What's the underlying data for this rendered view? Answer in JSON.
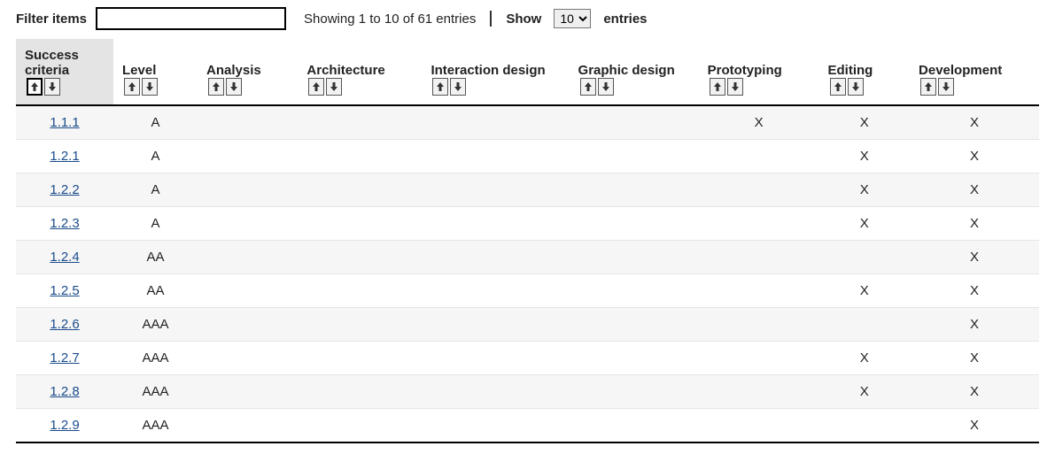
{
  "filter": {
    "label": "Filter items",
    "value": ""
  },
  "pagination": {
    "showing_text": "Showing 1 to 10 of 61 entries",
    "show_label_prefix": "Show",
    "show_label_suffix": "entries",
    "page_size": "10"
  },
  "columns": [
    {
      "key": "success_criteria",
      "label": "Success criteria",
      "sorted": true
    },
    {
      "key": "level",
      "label": "Level"
    },
    {
      "key": "analysis",
      "label": "Analysis"
    },
    {
      "key": "architecture",
      "label": "Architecture"
    },
    {
      "key": "interaction_design",
      "label": "Interaction design"
    },
    {
      "key": "graphic_design",
      "label": "Graphic design"
    },
    {
      "key": "prototyping",
      "label": "Prototyping"
    },
    {
      "key": "editing",
      "label": "Editing"
    },
    {
      "key": "development",
      "label": "Development"
    }
  ],
  "rows": [
    {
      "success_criteria": "1.1.1",
      "level": "A",
      "analysis": "",
      "architecture": "",
      "interaction_design": "",
      "graphic_design": "",
      "prototyping": "X",
      "editing": "X",
      "development": "X"
    },
    {
      "success_criteria": "1.2.1",
      "level": "A",
      "analysis": "",
      "architecture": "",
      "interaction_design": "",
      "graphic_design": "",
      "prototyping": "",
      "editing": "X",
      "development": "X"
    },
    {
      "success_criteria": "1.2.2",
      "level": "A",
      "analysis": "",
      "architecture": "",
      "interaction_design": "",
      "graphic_design": "",
      "prototyping": "",
      "editing": "X",
      "development": "X"
    },
    {
      "success_criteria": "1.2.3",
      "level": "A",
      "analysis": "",
      "architecture": "",
      "interaction_design": "",
      "graphic_design": "",
      "prototyping": "",
      "editing": "X",
      "development": "X"
    },
    {
      "success_criteria": "1.2.4",
      "level": "AA",
      "analysis": "",
      "architecture": "",
      "interaction_design": "",
      "graphic_design": "",
      "prototyping": "",
      "editing": "",
      "development": "X"
    },
    {
      "success_criteria": "1.2.5",
      "level": "AA",
      "analysis": "",
      "architecture": "",
      "interaction_design": "",
      "graphic_design": "",
      "prototyping": "",
      "editing": "X",
      "development": "X"
    },
    {
      "success_criteria": "1.2.6",
      "level": "AAA",
      "analysis": "",
      "architecture": "",
      "interaction_design": "",
      "graphic_design": "",
      "prototyping": "",
      "editing": "",
      "development": "X"
    },
    {
      "success_criteria": "1.2.7",
      "level": "AAA",
      "analysis": "",
      "architecture": "",
      "interaction_design": "",
      "graphic_design": "",
      "prototyping": "",
      "editing": "X",
      "development": "X"
    },
    {
      "success_criteria": "1.2.8",
      "level": "AAA",
      "analysis": "",
      "architecture": "",
      "interaction_design": "",
      "graphic_design": "",
      "prototyping": "",
      "editing": "X",
      "development": "X"
    },
    {
      "success_criteria": "1.2.9",
      "level": "AAA",
      "analysis": "",
      "architecture": "",
      "interaction_design": "",
      "graphic_design": "",
      "prototyping": "",
      "editing": "",
      "development": "X"
    }
  ]
}
